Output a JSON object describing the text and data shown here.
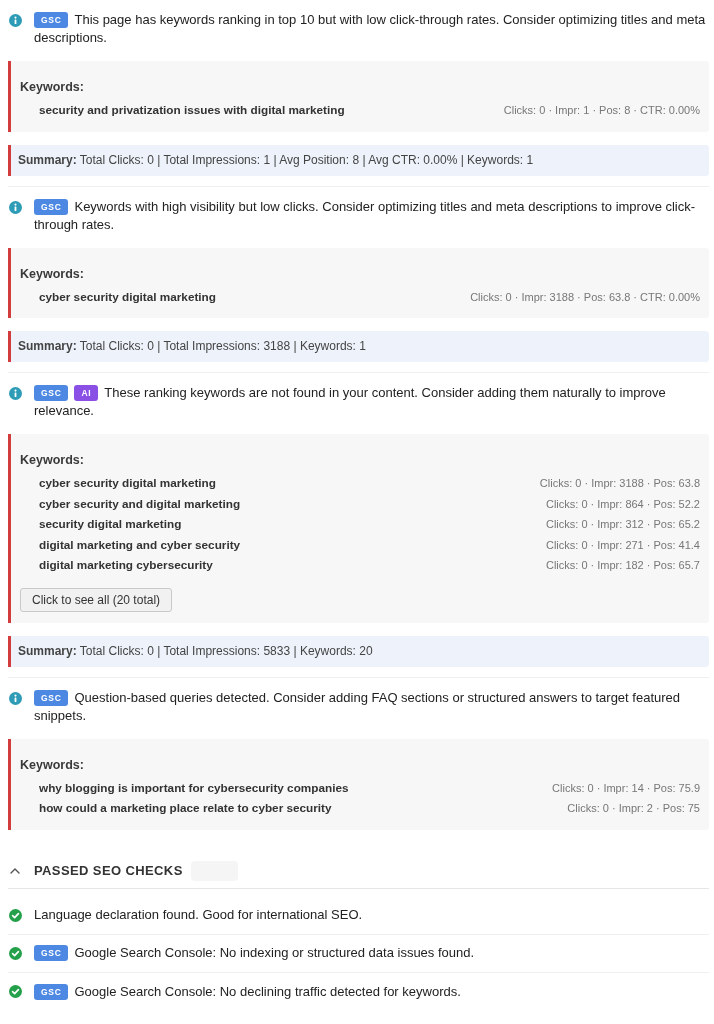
{
  "issues": [
    {
      "badges": [
        {
          "kind": "gsc",
          "label": "GSC"
        }
      ],
      "message": "This page has keywords ranking in top 10 but with low click-through rates. Consider optimizing titles and meta descriptions.",
      "keywords": {
        "label": "Keywords:",
        "rows": [
          {
            "keyword": "security and privatization issues with digital marketing",
            "stats": "Clicks: 0 · Impr: 1 · Pos: 8 · CTR: 0.00%"
          }
        ]
      },
      "summary": "**Summary:** Total Clicks: 0 | Total Impressions: 1 | Avg Position: 8 | Avg CTR: 0.00% | Keywords: 1"
    },
    {
      "badges": [
        {
          "kind": "gsc",
          "label": "GSC"
        }
      ],
      "message": "Keywords with high visibility but low clicks. Consider optimizing titles and meta descriptions to improve click-through rates.",
      "keywords": {
        "label": "Keywords:",
        "rows": [
          {
            "keyword": "cyber security digital marketing",
            "stats": "Clicks: 0 · Impr: 3188 · Pos: 63.8 · CTR: 0.00%"
          }
        ]
      },
      "summary": "**Summary:** Total Clicks: 0 | Total Impressions: 3188 | Keywords: 1"
    },
    {
      "badges": [
        {
          "kind": "gsc",
          "label": "GSC"
        },
        {
          "kind": "ai",
          "label": "AI"
        }
      ],
      "message": "These ranking keywords are not found in your content. Consider adding them naturally to improve relevance.",
      "keywords": {
        "label": "Keywords:",
        "rows": [
          {
            "keyword": "cyber security digital marketing",
            "stats": "Clicks: 0 · Impr: 3188 · Pos: 63.8"
          },
          {
            "keyword": "cyber security and digital marketing",
            "stats": "Clicks: 0 · Impr: 864 · Pos: 52.2"
          },
          {
            "keyword": "security digital marketing",
            "stats": "Clicks: 0 · Impr: 312 · Pos: 65.2"
          },
          {
            "keyword": "digital marketing and cyber security",
            "stats": "Clicks: 0 · Impr: 271 · Pos: 41.4"
          },
          {
            "keyword": "digital marketing cybersecurity",
            "stats": "Clicks: 0 · Impr: 182 · Pos: 65.7"
          }
        ],
        "more_button": "Click to see all (20 total)"
      },
      "summary": "**Summary:** Total Clicks: 0 | Total Impressions: 5833 | Keywords: 20"
    },
    {
      "badges": [
        {
          "kind": "gsc",
          "label": "GSC"
        }
      ],
      "message": "Question-based queries detected. Consider adding FAQ sections or structured answers to target featured snippets.",
      "keywords": {
        "label": "Keywords:",
        "rows": [
          {
            "keyword": "why blogging is important for cybersecurity companies",
            "stats": "Clicks: 0 · Impr: 14 · Pos: 75.9"
          },
          {
            "keyword": "how could a marketing place relate to cyber security",
            "stats": "Clicks: 0 · Impr: 2 · Pos: 75"
          }
        ]
      }
    }
  ],
  "passed_checks": {
    "title": "PASSED SEO CHECKS",
    "expanded": true,
    "items": [
      {
        "message": "Language declaration found. Good for international SEO."
      },
      {
        "badges": [
          {
            "kind": "gsc",
            "label": "GSC"
          }
        ],
        "message": "Google Search Console: No indexing or structured data issues found."
      },
      {
        "badges": [
          {
            "kind": "gsc",
            "label": "GSC"
          }
        ],
        "message": "Google Search Console: No declining traffic detected for keywords."
      }
    ]
  }
}
